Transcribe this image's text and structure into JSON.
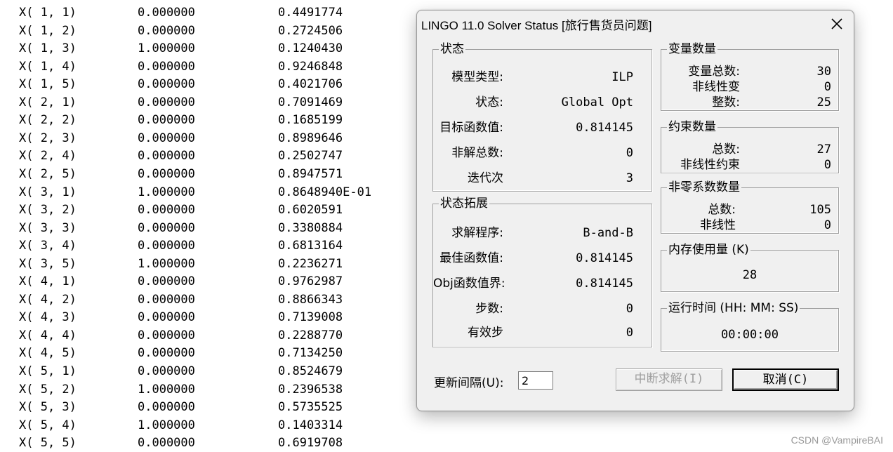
{
  "report": {
    "rows": [
      {
        "var": "X( 1, 1)",
        "value": "0.000000",
        "cost": "0.4491774"
      },
      {
        "var": "X( 1, 2)",
        "value": "0.000000",
        "cost": "0.2724506"
      },
      {
        "var": "X( 1, 3)",
        "value": "1.000000",
        "cost": "0.1240430"
      },
      {
        "var": "X( 1, 4)",
        "value": "0.000000",
        "cost": "0.9246848"
      },
      {
        "var": "X( 1, 5)",
        "value": "0.000000",
        "cost": "0.4021706"
      },
      {
        "var": "X( 2, 1)",
        "value": "0.000000",
        "cost": "0.7091469"
      },
      {
        "var": "X( 2, 2)",
        "value": "0.000000",
        "cost": "0.1685199"
      },
      {
        "var": "X( 2, 3)",
        "value": "0.000000",
        "cost": "0.8989646"
      },
      {
        "var": "X( 2, 4)",
        "value": "0.000000",
        "cost": "0.2502747"
      },
      {
        "var": "X( 2, 5)",
        "value": "0.000000",
        "cost": "0.8947571"
      },
      {
        "var": "X( 3, 1)",
        "value": "1.000000",
        "cost": "0.8648940E-01"
      },
      {
        "var": "X( 3, 2)",
        "value": "0.000000",
        "cost": "0.6020591"
      },
      {
        "var": "X( 3, 3)",
        "value": "0.000000",
        "cost": "0.3380884"
      },
      {
        "var": "X( 3, 4)",
        "value": "0.000000",
        "cost": "0.6813164"
      },
      {
        "var": "X( 3, 5)",
        "value": "1.000000",
        "cost": "0.2236271"
      },
      {
        "var": "X( 4, 1)",
        "value": "0.000000",
        "cost": "0.9762987"
      },
      {
        "var": "X( 4, 2)",
        "value": "0.000000",
        "cost": "0.8866343"
      },
      {
        "var": "X( 4, 3)",
        "value": "0.000000",
        "cost": "0.7139008"
      },
      {
        "var": "X( 4, 4)",
        "value": "0.000000",
        "cost": "0.2288770"
      },
      {
        "var": "X( 4, 5)",
        "value": "0.000000",
        "cost": "0.7134250"
      },
      {
        "var": "X( 5, 1)",
        "value": "0.000000",
        "cost": "0.8524679"
      },
      {
        "var": "X( 5, 2)",
        "value": "1.000000",
        "cost": "0.2396538"
      },
      {
        "var": "X( 5, 3)",
        "value": "0.000000",
        "cost": "0.5735525"
      },
      {
        "var": "X( 5, 4)",
        "value": "1.000000",
        "cost": "0.1403314"
      },
      {
        "var": "X( 5, 5)",
        "value": "0.000000",
        "cost": "0.6919708"
      }
    ]
  },
  "dialog": {
    "title": "LINGO 11.0 Solver Status [旅行售货员问题]",
    "close_icon": "close-icon",
    "status": {
      "legend": "状态",
      "model_type_label": "模型类型:",
      "model_type_value": "ILP",
      "state_label": "状态:",
      "state_value": "Global Opt",
      "objective_label": "目标函数值:",
      "objective_value": "0.814145",
      "infeasibility_label": "非解总数:",
      "infeasibility_value": "0",
      "iterations_label": "迭代次",
      "iterations_value": "3"
    },
    "extended": {
      "legend": "状态拓展",
      "solver_label": "求解程序:",
      "solver_value": "B-and-B",
      "best_obj_label": "最佳函数值:",
      "best_obj_value": "0.814145",
      "obj_bound_label": "Obj函数值界:",
      "obj_bound_value": "0.814145",
      "steps_label": "步数:",
      "steps_value": "0",
      "active_label": "有效步",
      "active_value": "0"
    },
    "variables": {
      "legend": "变量数量",
      "total_label": "变量总数:",
      "total_value": "30",
      "nonlinear_label": "非线性变",
      "nonlinear_value": "0",
      "integer_label": "整数:",
      "integer_value": "25"
    },
    "constraints": {
      "legend": "约束数量",
      "total_label": "总数:",
      "total_value": "27",
      "nonlinear_label": "非线性约束",
      "nonlinear_value": "0"
    },
    "nonzeros": {
      "legend": "非零系数数量",
      "total_label": "总数:",
      "total_value": "105",
      "nonlinear_label": "非线性",
      "nonlinear_value": "0"
    },
    "memory": {
      "legend": "内存使用量 (K)",
      "value": "28"
    },
    "runtime": {
      "legend": "运行时间 (HH: MM: SS)",
      "value": "00:00:00"
    },
    "update_interval_label": "更新间隔(U):",
    "update_interval_value": "2",
    "interrupt_label": "中断求解(I)",
    "cancel_label": "取消(C)"
  },
  "watermark": "CSDN @VampireBAI"
}
